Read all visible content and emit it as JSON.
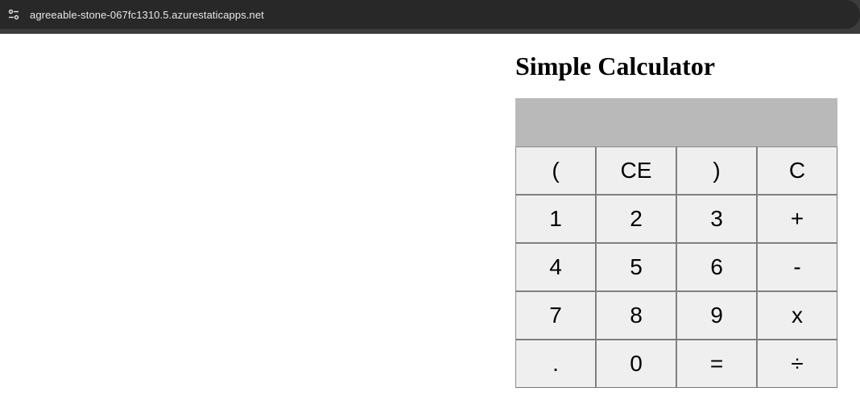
{
  "browser": {
    "url": "agreeable-stone-067fc1310.5.azurestaticapps.net",
    "site_info_icon": "tune-icon"
  },
  "page": {
    "title": "Simple Calculator",
    "display_value": ""
  },
  "colors": {
    "toolbar_bg": "#3c3c3c",
    "omnibox_bg": "#282828",
    "display_bg": "#b9b9b9",
    "key_bg": "#efefef",
    "key_border": "#767676"
  },
  "keys": [
    {
      "id": "open-paren",
      "label": "("
    },
    {
      "id": "clear-entry",
      "label": "CE"
    },
    {
      "id": "close-paren",
      "label": ")"
    },
    {
      "id": "clear",
      "label": "C"
    },
    {
      "id": "digit-1",
      "label": "1"
    },
    {
      "id": "digit-2",
      "label": "2"
    },
    {
      "id": "digit-3",
      "label": "3"
    },
    {
      "id": "add",
      "label": "+"
    },
    {
      "id": "digit-4",
      "label": "4"
    },
    {
      "id": "digit-5",
      "label": "5"
    },
    {
      "id": "digit-6",
      "label": "6"
    },
    {
      "id": "subtract",
      "label": "-"
    },
    {
      "id": "digit-7",
      "label": "7"
    },
    {
      "id": "digit-8",
      "label": "8"
    },
    {
      "id": "digit-9",
      "label": "9"
    },
    {
      "id": "multiply",
      "label": "x"
    },
    {
      "id": "decimal",
      "label": "."
    },
    {
      "id": "digit-0",
      "label": "0"
    },
    {
      "id": "equals",
      "label": "="
    },
    {
      "id": "divide",
      "label": "÷"
    }
  ]
}
